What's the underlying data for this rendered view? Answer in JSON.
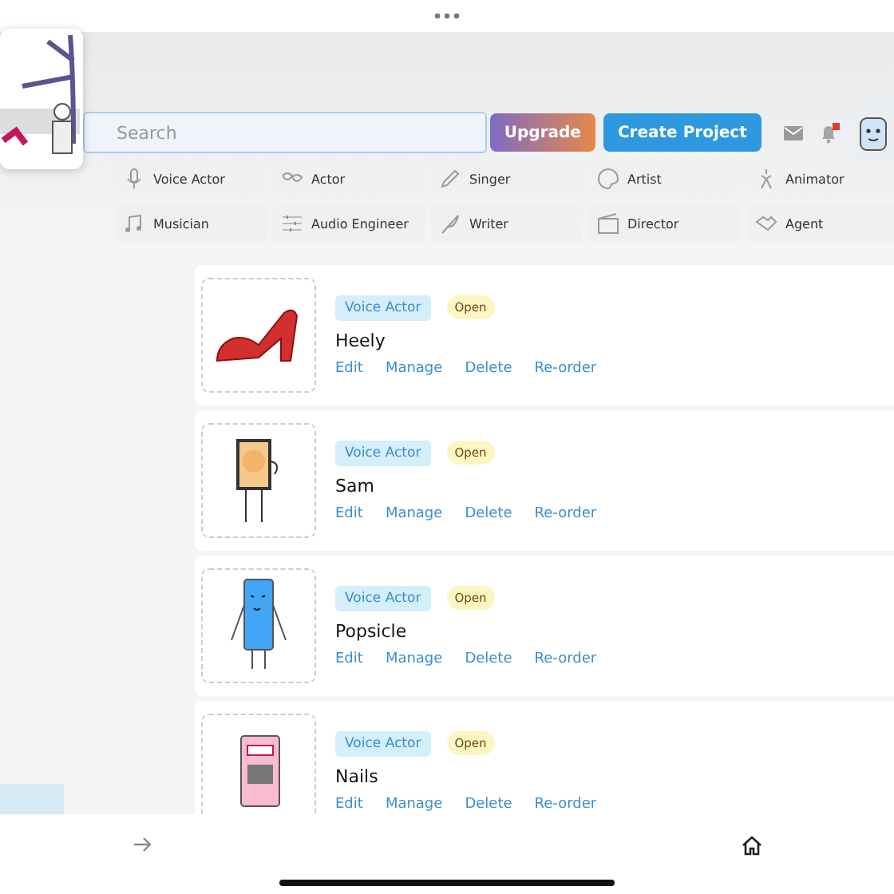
{
  "search": {
    "placeholder": "Search"
  },
  "header_buttons": [
    {
      "label": "Upgrade",
      "kind": "gradient"
    },
    {
      "label": "Create Project",
      "kind": "primary"
    }
  ],
  "notifications": {
    "unread": true
  },
  "categories": [
    {
      "label": "Voice Actor"
    },
    {
      "label": "Actor"
    },
    {
      "label": "Singer"
    },
    {
      "label": "Artist"
    },
    {
      "label": "Animator"
    },
    {
      "label": "Musician"
    },
    {
      "label": "Audio Engineer"
    },
    {
      "label": "Writer"
    },
    {
      "label": "Director"
    },
    {
      "label": "Agent"
    }
  ],
  "projects": [
    {
      "kind": "shoe",
      "tag": "Voice Actor",
      "status": "Open",
      "name": "Heely",
      "actions": [
        "Edit",
        "Manage",
        "Delete",
        "Re-order"
      ]
    },
    {
      "kind": "tablet",
      "tag": "Voice Actor",
      "status": "Open",
      "name": "Sam",
      "actions": [
        "Edit",
        "Manage",
        "Delete",
        "Re-order"
      ]
    },
    {
      "kind": "popsicle",
      "tag": "Voice Actor",
      "status": "Open",
      "name": "Popsicle",
      "actions": [
        "Edit",
        "Manage",
        "Delete",
        "Re-order"
      ]
    },
    {
      "kind": "phone",
      "tag": "Voice Actor",
      "status": "Open",
      "name": "Nails",
      "actions": [
        "Edit",
        "Manage",
        "Delete",
        "Re-order"
      ]
    }
  ]
}
